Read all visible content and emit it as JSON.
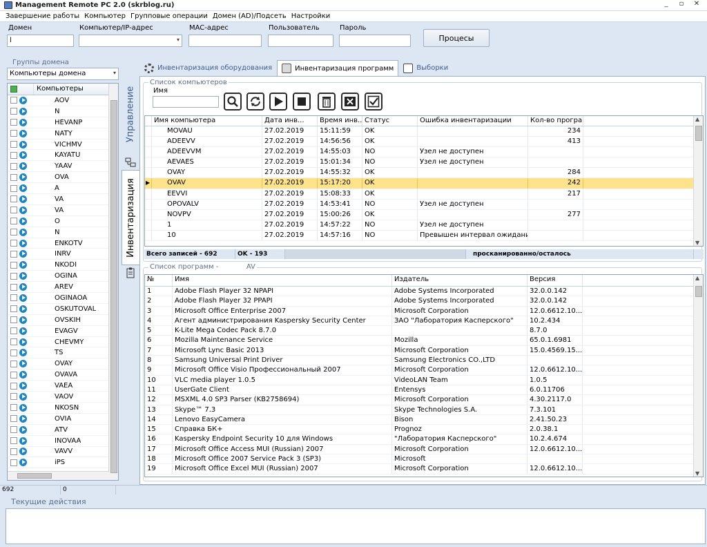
{
  "window": {
    "title": "Management Remote PC 2.0 (skrblog.ru)",
    "min": "_",
    "max": "▫",
    "close": "✕"
  },
  "menu": [
    "Завершение работы",
    "Компьютер",
    "Групповые операции",
    "Домен (AD)/Подсеть",
    "Настройки"
  ],
  "form": {
    "domain_label": "Домен",
    "domain_value": "l",
    "computer_label": "Компьютер/IP-адрес",
    "computer_value": "",
    "mac_label": "MAC-адрес",
    "mac_value": "",
    "user_label": "Пользователь",
    "user_value": "",
    "password_label": "Пароль",
    "password_value": "",
    "process_button": "Процесы"
  },
  "left": {
    "group_title": "Группы домена",
    "combo_value": "Компьютеры домена",
    "column_header": "Компьютеры",
    "computers": [
      "AOV",
      "N",
      "HEVANP",
      "NATY",
      "VICHMV",
      "KAYATU",
      "YAAV",
      "OVA",
      "A",
      "VA",
      "VA",
      "O",
      "N",
      "ENKOTV",
      "INRV",
      "NKODI",
      "OGINA",
      "AREV",
      "OGINAOA",
      "OSKUTOVAL",
      "OVSKIH",
      "EVAGV",
      "CHEVMY",
      "TS",
      "OVAY",
      "OVAVA",
      "VAEA",
      "VAOV",
      "NKOSN",
      "OVIA",
      "ATV",
      "INOVAA",
      "VAVV",
      "iPS"
    ],
    "count": "692"
  },
  "side_tabs": {
    "manage": "Управление",
    "inventory": "Инвентаризация"
  },
  "tabs": [
    {
      "label": "Инвентаризация оборудования",
      "active": false
    },
    {
      "label": "Инвентаризация программ",
      "active": true
    },
    {
      "label": "Выборки",
      "active": false
    }
  ],
  "computers_group": {
    "title": "Список компьютеров",
    "name_label": "Имя",
    "name_value": "",
    "columns": [
      "Имя компьютера",
      "Дата инв...",
      "Время инв...",
      "Статус",
      "Ошибка инвентаризации",
      "Кол-во программ"
    ],
    "rows": [
      {
        "name": "MOVAU",
        "date": "27.02.2019",
        "time": "15:11:59",
        "status": "OK",
        "error": "",
        "count": "234"
      },
      {
        "name": "ADEEVV",
        "date": "27.02.2019",
        "time": "14:56:56",
        "status": "OK",
        "error": "",
        "count": "413"
      },
      {
        "name": "ADEEVVM",
        "date": "27.02.2019",
        "time": "14:55:03",
        "status": "NO",
        "error": "Узел не доступен",
        "count": ""
      },
      {
        "name": "AEVAES",
        "date": "27.02.2019",
        "time": "15:01:34",
        "status": "NO",
        "error": "Узел не доступен",
        "count": ""
      },
      {
        "name": "OVAY",
        "date": "27.02.2019",
        "time": "14:55:32",
        "status": "OK",
        "error": "",
        "count": "284"
      },
      {
        "name": "OVAV",
        "date": "27.02.2019",
        "time": "15:17:20",
        "status": "OK",
        "error": "",
        "count": "242"
      },
      {
        "name": "EEVVI",
        "date": "27.02.2019",
        "time": "15:08:33",
        "status": "OK",
        "error": "",
        "count": "217"
      },
      {
        "name": "OPOVALV",
        "date": "27.02.2019",
        "time": "14:53:41",
        "status": "NO",
        "error": "Узел не доступен",
        "count": ""
      },
      {
        "name": "NOVPV",
        "date": "27.02.2019",
        "time": "15:00:26",
        "status": "OK",
        "error": "",
        "count": "277"
      },
      {
        "name": "1",
        "date": "27.02.2019",
        "time": "14:57:22",
        "status": "NO",
        "error": "Узел не доступен",
        "count": ""
      },
      {
        "name": "10",
        "date": "27.02.2019",
        "time": "14:57:16",
        "status": "NO",
        "error": "Превышен интервал ожидания зап",
        "count": ""
      }
    ],
    "status_total": "Всего записей - 692",
    "status_ok": "OK - 193",
    "status_scan": "просканированно/осталось"
  },
  "programs_group": {
    "title": "Список программ -",
    "title_suffix": "AV",
    "columns": [
      "№",
      "Имя",
      "Издатель",
      "Версия"
    ],
    "rows": [
      {
        "n": "1",
        "name": "Adobe Flash Player 32 NPAPI",
        "publisher": "Adobe Systems Incorporated",
        "version": "32.0.0.142"
      },
      {
        "n": "2",
        "name": "Adobe Flash Player 32 PPAPI",
        "publisher": "Adobe Systems Incorporated",
        "version": "32.0.0.142"
      },
      {
        "n": "3",
        "name": "Microsoft Office Enterprise 2007",
        "publisher": "Microsoft Corporation",
        "version": "12.0.6612.10..."
      },
      {
        "n": "4",
        "name": "Агент администрирования Kaspersky Security Center",
        "publisher": "ЗАО \"Лаборатория Касперского\"",
        "version": "10.2.434"
      },
      {
        "n": "5",
        "name": "K-Lite Mega Codec Pack 8.7.0",
        "publisher": "",
        "version": "8.7.0"
      },
      {
        "n": "6",
        "name": "Mozilla Maintenance Service",
        "publisher": "Mozilla",
        "version": "65.0.1.6981"
      },
      {
        "n": "7",
        "name": "Microsoft Lync Basic 2013",
        "publisher": "Microsoft Corporation",
        "version": "15.0.4569.15..."
      },
      {
        "n": "8",
        "name": "Samsung Universal Print Driver",
        "publisher": "Samsung Electronics CO.,LTD",
        "version": ""
      },
      {
        "n": "9",
        "name": "Microsoft Office Visio Профессиональный 2007",
        "publisher": "Microsoft Corporation",
        "version": "12.0.6612.10..."
      },
      {
        "n": "10",
        "name": "VLC media player 1.0.5",
        "publisher": "VideoLAN Team",
        "version": "1.0.5"
      },
      {
        "n": "11",
        "name": "UserGate Client",
        "publisher": "Entensys",
        "version": "6.0.11706"
      },
      {
        "n": "12",
        "name": "MSXML 4.0 SP3 Parser (KB2758694)",
        "publisher": "Microsoft Corporation",
        "version": "4.30.2117.0"
      },
      {
        "n": "13",
        "name": "Skype™ 7.3",
        "publisher": "Skype Technologies S.A.",
        "version": "7.3.101"
      },
      {
        "n": "14",
        "name": "Lenovo EasyCamera",
        "publisher": "Bison",
        "version": "2.41.50.23"
      },
      {
        "n": "15",
        "name": "Справка БК+",
        "publisher": "Prognoz",
        "version": "2.0.38.1"
      },
      {
        "n": "16",
        "name": "Kaspersky Endpoint Security 10 для Windows",
        "publisher": "\"Лаборатория Касперского\"",
        "version": "10.2.4.674"
      },
      {
        "n": "17",
        "name": "Microsoft Office Access MUI (Russian) 2007",
        "publisher": "Microsoft Corporation",
        "version": "12.0.6612.10..."
      },
      {
        "n": "18",
        "name": "Microsoft Office 2007 Service Pack 3 (SP3)",
        "publisher": "Microsoft",
        "version": ""
      },
      {
        "n": "19",
        "name": "Microsoft Office Excel MUI (Russian) 2007",
        "publisher": "Microsoft Corporation",
        "version": "12.0.6612.10..."
      }
    ]
  },
  "bottom": {
    "count": "692",
    "value2": "0"
  },
  "actions": {
    "title": "Текущие действия"
  }
}
